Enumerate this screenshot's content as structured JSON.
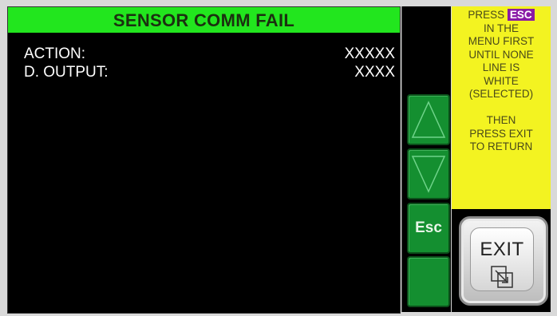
{
  "title": "SENSOR COMM FAIL",
  "rows": [
    {
      "label": "ACTION:",
      "value": "XXXXX"
    },
    {
      "label": "D. OUTPUT:",
      "value": "XXXX"
    }
  ],
  "buttons": {
    "up_icon": "up-triangle-icon",
    "down_icon": "down-triangle-icon",
    "esc_label": "Esc",
    "blank": ""
  },
  "notice": {
    "press": "PRESS",
    "esc": "ESC",
    "lines": [
      "IN THE",
      "MENU FIRST",
      "UNTIL NONE",
      "LINE IS",
      "WHITE",
      "(SELECTED)",
      "",
      "THEN",
      "PRESS EXIT",
      "TO RETURN"
    ]
  },
  "exit": {
    "label": "EXIT",
    "icon": "exit-squares-icon"
  },
  "colors": {
    "title_bg": "#22e61e",
    "button_green": "#148f30",
    "notice_bg": "#f3f321",
    "esc_tag": "#8a1aa6"
  }
}
